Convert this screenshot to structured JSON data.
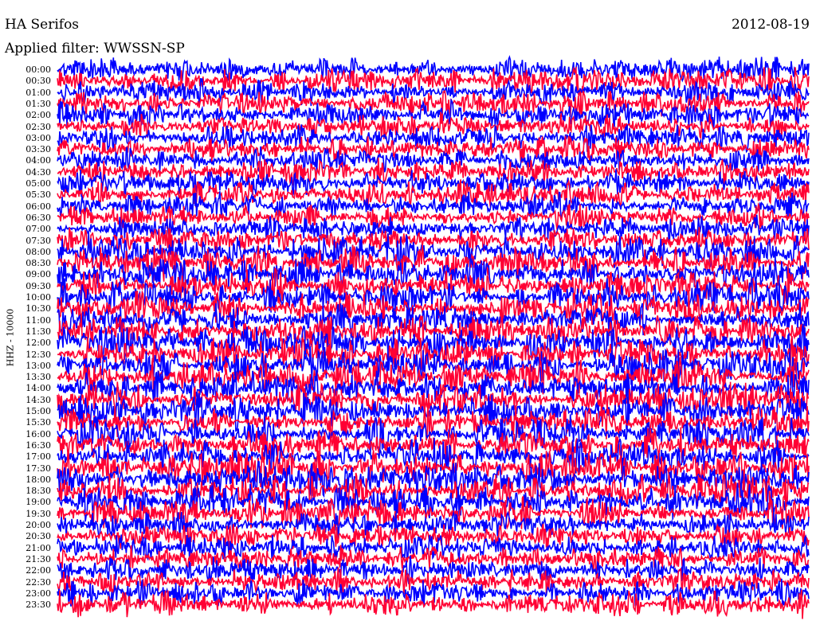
{
  "header": {
    "station": "HA Serifos",
    "date": "2012-08-19",
    "filter": "Applied filter: WWSSN-SP"
  },
  "chart_data": {
    "type": "line",
    "title": "HA Serifos",
    "date": "2012-08-19",
    "filter": "Applied filter: WWSSN-SP",
    "ylabel": "HHZ - 10000",
    "row_labels": [
      "00:00",
      "00:30",
      "01:00",
      "01:30",
      "02:00",
      "02:30",
      "03:00",
      "03:30",
      "04:00",
      "04:30",
      "05:00",
      "05:30",
      "06:00",
      "06:30",
      "07:00",
      "07:30",
      "08:00",
      "08:30",
      "09:00",
      "09:30",
      "10:00",
      "10:30",
      "11:00",
      "11:30",
      "12:00",
      "12:30",
      "13:00",
      "13:30",
      "14:00",
      "14:30",
      "15:00",
      "15:30",
      "16:00",
      "16:30",
      "17:00",
      "17:30",
      "18:00",
      "18:30",
      "19:00",
      "19:30",
      "20:00",
      "20:30",
      "21:00",
      "21:30",
      "22:00",
      "22:30",
      "23:00",
      "23:30"
    ],
    "series_colors": [
      "#0000ff",
      "#ff0033"
    ],
    "trace_duration_minutes": 30,
    "grid": false
  }
}
